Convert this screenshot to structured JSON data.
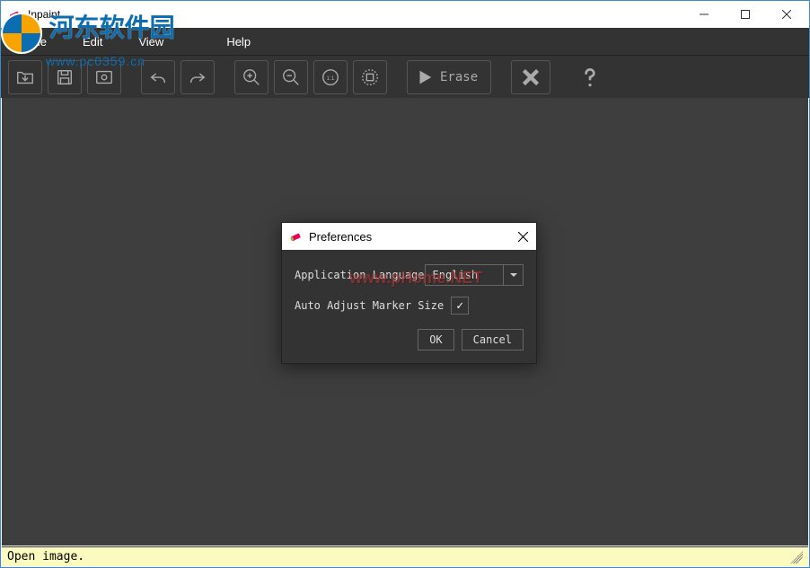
{
  "window": {
    "title": "Inpaint"
  },
  "menus": {
    "file": "File",
    "edit": "Edit",
    "view": "View",
    "help": "Help"
  },
  "toolbar": {
    "erase_label": "Erase"
  },
  "statusbar": {
    "message": "Open image."
  },
  "dialog": {
    "title": "Preferences",
    "lang_label": "Application Language",
    "lang_value": "English",
    "auto_adjust_label": "Auto Adjust Marker Size",
    "auto_adjust_checked": true,
    "ok": "OK",
    "cancel": "Cancel"
  },
  "watermark": {
    "site1_name": "河东软件园",
    "site1_url": "www.pc0359.cn",
    "site2": "www.pHome.NET"
  }
}
